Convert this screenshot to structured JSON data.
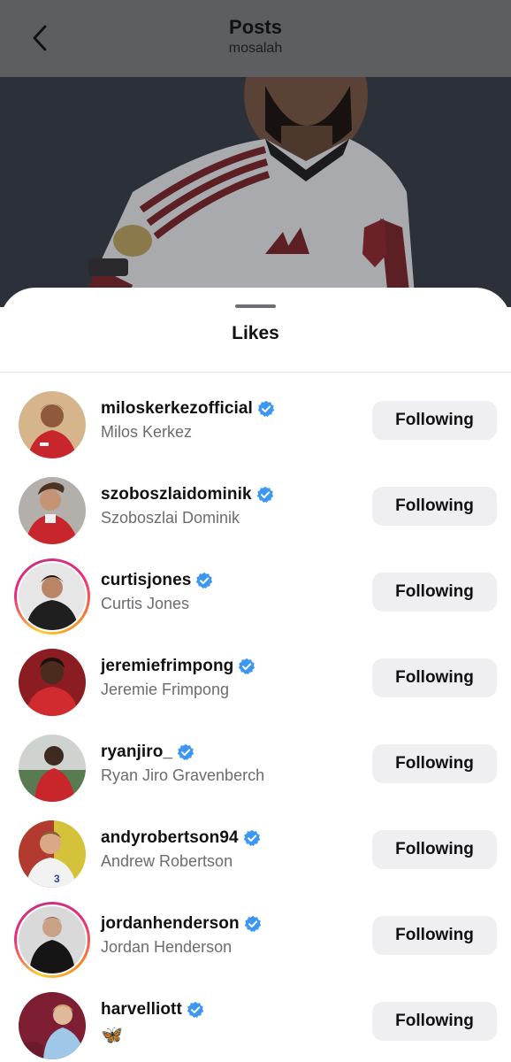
{
  "header": {
    "title": "Posts",
    "subtitle": "mosalah"
  },
  "sheet": {
    "title": "Likes"
  },
  "colors": {
    "verified": "#3b97f3",
    "button_bg": "#efeff2",
    "secondary_text": "#6c6c70"
  },
  "likes": [
    {
      "username": "miloskerkezofficial",
      "full_name": "Milos Kerkez",
      "verified": true,
      "story_ring": false,
      "button": "Following"
    },
    {
      "username": "szoboszlaidominik",
      "full_name": "Szoboszlai Dominik",
      "verified": true,
      "story_ring": false,
      "button": "Following"
    },
    {
      "username": "curtisjones",
      "full_name": "Curtis Jones",
      "verified": true,
      "story_ring": true,
      "button": "Following"
    },
    {
      "username": "jeremiefrimpong",
      "full_name": "Jeremie Frimpong",
      "verified": true,
      "story_ring": false,
      "button": "Following"
    },
    {
      "username": "ryanjiro_",
      "full_name": "Ryan Jiro Gravenberch",
      "verified": true,
      "story_ring": false,
      "button": "Following"
    },
    {
      "username": "andyrobertson94",
      "full_name": "Andrew Robertson",
      "verified": true,
      "story_ring": false,
      "button": "Following"
    },
    {
      "username": "jordanhenderson",
      "full_name": "Jordan Henderson",
      "verified": true,
      "story_ring": true,
      "button": "Following"
    },
    {
      "username": "harvelliott",
      "full_name": "🦋",
      "verified": true,
      "story_ring": false,
      "button": "Following"
    }
  ],
  "icons": {
    "back": "chevron-left-icon",
    "verified": "verified-badge-icon"
  }
}
